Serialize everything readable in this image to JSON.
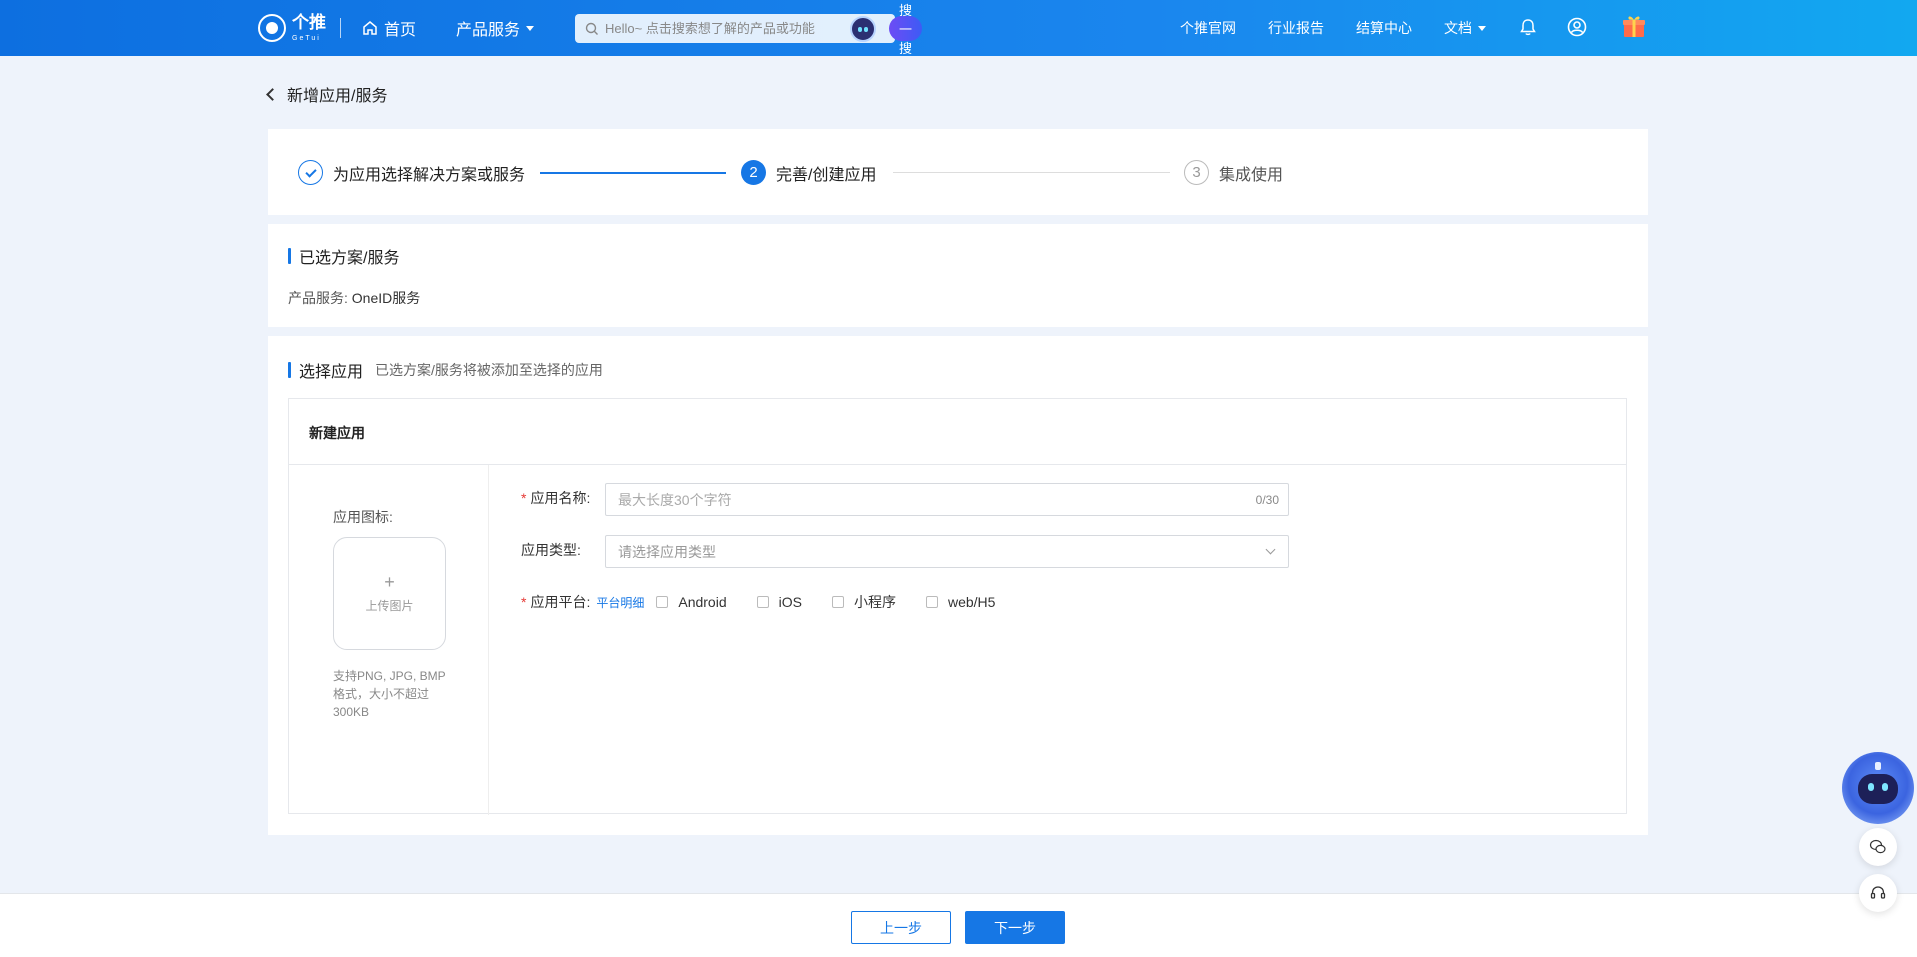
{
  "header": {
    "logo_text": "个推",
    "logo_sub": "GeTui",
    "home": "首页",
    "products": "产品服务",
    "search_placeholder": "Hello~ 点击搜索想了解的产品或功能",
    "search_button": "搜一搜",
    "links": [
      "个推官网",
      "行业报告",
      "结算中心"
    ],
    "docs": "文档"
  },
  "page": {
    "title": "新增应用/服务"
  },
  "steps": [
    {
      "label": "为应用选择解决方案或服务",
      "state": "done"
    },
    {
      "label": "完善/创建应用",
      "number": "2",
      "state": "active"
    },
    {
      "label": "集成使用",
      "number": "3",
      "state": "pending"
    }
  ],
  "selected": {
    "title": "已选方案/服务",
    "product_label": "产品服务:",
    "product_value": "OneID服务"
  },
  "select_app": {
    "title": "选择应用",
    "subtitle": "已选方案/服务将被添加至选择的应用",
    "tab": "新建应用",
    "icon_label": "应用图标:",
    "upload_plus": "+",
    "upload_text": "上传图片",
    "upload_hint": "支持PNG, JPG, BMP格式，大小不超过300KB",
    "name_label": "应用名称:",
    "name_placeholder": "最大长度30个字符",
    "name_counter": "0/30",
    "type_label": "应用类型:",
    "type_placeholder": "请选择应用类型",
    "platform_label": "应用平台:",
    "platform_link": "平台明细",
    "platforms": [
      "Android",
      "iOS",
      "小程序",
      "web/H5"
    ]
  },
  "footer": {
    "prev": "上一步",
    "next": "下一步"
  },
  "colors": {
    "primary": "#1677e5",
    "required": "#e53935"
  }
}
